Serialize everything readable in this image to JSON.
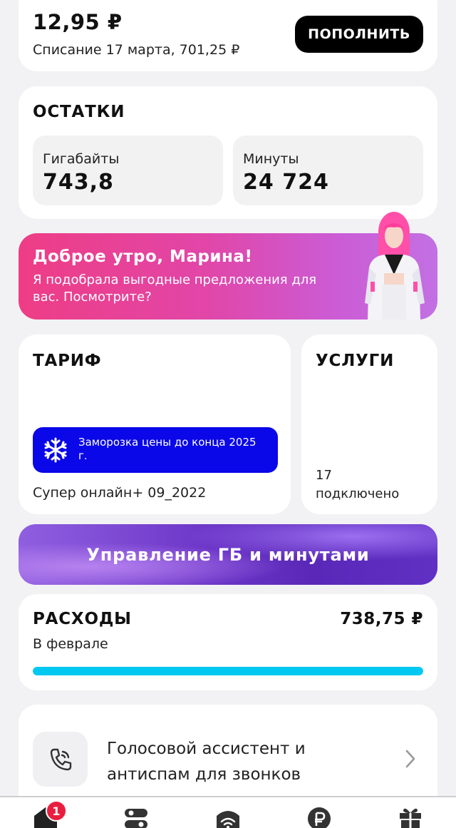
{
  "balance": {
    "amount": "12,95 ₽",
    "writeoff": "Списание 17 марта, 701,25 ₽",
    "topup_label": "ПОПОЛНИТЬ"
  },
  "remains": {
    "title": "ОСТАТКИ",
    "gigabytes_label": "Гигабайты",
    "gigabytes_value": "743,8",
    "minutes_label": "Минуты",
    "minutes_value": "24 724"
  },
  "assistant_banner": {
    "greeting": "Доброе утро, Марина!",
    "text": "Я подобрала выгодные предложения для вас. Посмотрите?"
  },
  "tariff": {
    "title": "ТАРИФ",
    "freeze_text": "Заморозка цены до конца 2025 г.",
    "name": "Супер онлайн+ 09_2022"
  },
  "services": {
    "title": "УСЛУГИ",
    "count_line1": "17",
    "count_line2": "подключено"
  },
  "manage": {
    "label": "Управление ГБ и минутами"
  },
  "expenses": {
    "title": "РАСХОДЫ",
    "amount": "738,75 ₽",
    "period": "В феврале",
    "progress": 1.0
  },
  "voice_assistant": {
    "text": "Голосовой ассистент и антиспам для звонков"
  },
  "bottom_nav": {
    "items": [
      "home-icon",
      "services-icon",
      "wifi-icon",
      "ruble-icon",
      "gift-icon"
    ],
    "badge": "1"
  },
  "colors": {
    "accent_black": "#000000",
    "freeze_blue": "#0a07e8",
    "expenses_bar": "#00c8f0",
    "badge_red": "#e91e3f",
    "banner_pink": "#ee3d85",
    "manage_purple": "#6d36c8"
  }
}
